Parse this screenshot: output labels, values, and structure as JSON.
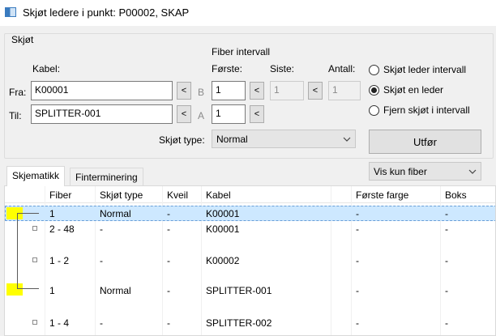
{
  "window": {
    "title": "Skjøt ledere i punkt: P00002, SKAP"
  },
  "group": {
    "title": "Skjøt",
    "kabel_label": "Kabel:",
    "fiber_intervall_label": "Fiber intervall",
    "forste_label": "Første:",
    "siste_label": "Siste:",
    "antall_label": "Antall:",
    "fra_label": "Fra:",
    "til_label": "Til:",
    "fra_kabel": "K00001",
    "til_kabel": "SPLITTER-001",
    "fra_letter": "B",
    "til_letter": "A",
    "prev_button_label": "<",
    "fra_forste": "1",
    "til_forste": "1",
    "fra_siste": "1",
    "fra_antall": "1",
    "skjot_type_label": "Skjøt type:",
    "skjot_type_value": "Normal"
  },
  "radio_options": [
    {
      "label": "Skjøt leder intervall",
      "selected": false
    },
    {
      "label": "Skjøt en leder",
      "selected": true
    },
    {
      "label": "Fjern skjøt i intervall",
      "selected": false
    }
  ],
  "action_button": {
    "label": "Utfør"
  },
  "filter_combo": {
    "value": "Vis kun fiber"
  },
  "tabs": [
    {
      "label": "Skjematikk",
      "active": true
    },
    {
      "label": "Finterminering",
      "active": false
    }
  ],
  "table": {
    "columns": [
      "Fiber",
      "Skjøt type",
      "Kveil",
      "Kabel",
      "Første farge",
      "Boks"
    ],
    "rows": [
      {
        "fiber": "1",
        "skjot_type": "Normal",
        "kveil": "-",
        "kabel": "K00001",
        "forste_farge": "-",
        "boks": "-",
        "selected": true
      },
      {
        "fiber": "2 - 48",
        "skjot_type": "-",
        "kveil": "-",
        "kabel": "K00001",
        "forste_farge": "-",
        "boks": "-",
        "selected": false
      },
      {
        "fiber": "1 - 2",
        "skjot_type": "-",
        "kveil": "-",
        "kabel": "K00002",
        "forste_farge": "-",
        "boks": "-",
        "selected": false
      },
      {
        "fiber": "1",
        "skjot_type": "Normal",
        "kveil": "-",
        "kabel": "SPLITTER-001",
        "forste_farge": "-",
        "boks": "-",
        "selected": false
      },
      {
        "fiber": "1 - 4",
        "skjot_type": "-",
        "kveil": "-",
        "kabel": "SPLITTER-002",
        "forste_farge": "-",
        "boks": "-",
        "selected": false
      }
    ]
  },
  "colors": {
    "selection": "#cde8ff",
    "highlight": "#ffff00",
    "window_bg": "#f0f0f0"
  }
}
